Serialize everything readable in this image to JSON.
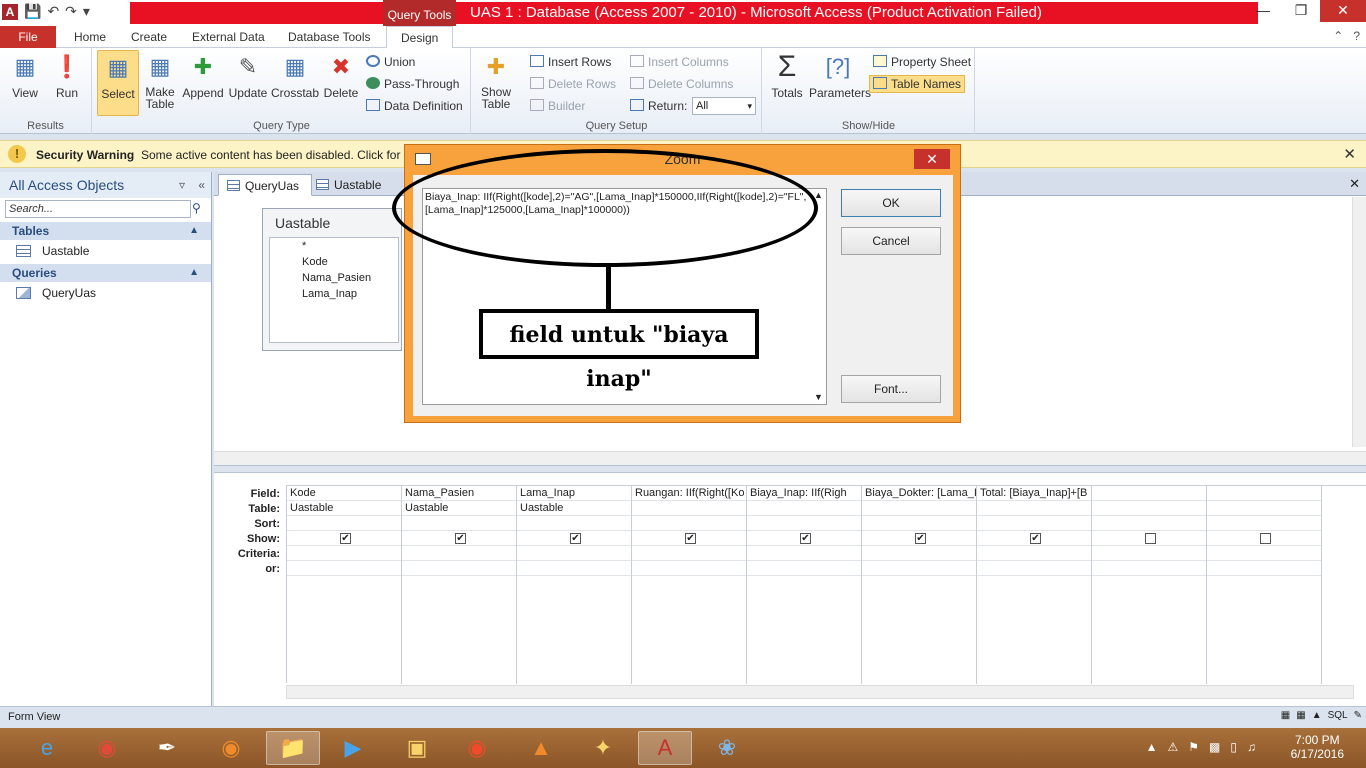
{
  "app": {
    "context_tab": "Query Tools",
    "window_title": "UAS 1 : Database (Access 2007 - 2010)  -  Microsoft Access (Product Activation Failed)",
    "icon_letter": "A"
  },
  "tabs": [
    "File",
    "Home",
    "Create",
    "External Data",
    "Database Tools",
    "Design"
  ],
  "ribbon": {
    "results": {
      "label": "Results",
      "view": "View",
      "run": "Run"
    },
    "query_type": {
      "label": "Query Type",
      "select": "Select",
      "make_table": "Make Table",
      "append": "Append",
      "update": "Update",
      "crosstab": "Crosstab",
      "delete": "Delete",
      "union": "Union",
      "pass_through": "Pass-Through",
      "data_definition": "Data Definition"
    },
    "query_setup": {
      "label": "Query Setup",
      "show_table": "Show Table",
      "insert_rows": "Insert Rows",
      "delete_rows": "Delete Rows",
      "builder": "Builder",
      "insert_columns": "Insert Columns",
      "delete_columns": "Delete Columns",
      "return_label": "Return:",
      "return_value": "All"
    },
    "show_hide": {
      "label": "Show/Hide",
      "totals": "Totals",
      "parameters": "Parameters",
      "property_sheet": "Property Sheet",
      "table_names": "Table Names"
    }
  },
  "security": {
    "title": "Security Warning",
    "message": "Some active content has been disabled. Click for mo"
  },
  "nav": {
    "header": "All Access Objects",
    "search_placeholder": "Search...",
    "groups": [
      {
        "name": "Tables",
        "items": [
          "Uastable"
        ]
      },
      {
        "name": "Queries",
        "items": [
          "QueryUas"
        ]
      }
    ]
  },
  "doc_tabs": [
    "QueryUas",
    "Uastable"
  ],
  "table_box": {
    "name": "Uastable",
    "fields": [
      "*",
      "Kode",
      "Nama_Pasien",
      "Lama_Inap"
    ]
  },
  "grid": {
    "row_labels": [
      "Field:",
      "Table:",
      "Sort:",
      "Show:",
      "Criteria:",
      "or:"
    ],
    "columns": [
      {
        "field": "Kode",
        "table": "Uastable",
        "show": true
      },
      {
        "field": "Nama_Pasien",
        "table": "Uastable",
        "show": true
      },
      {
        "field": "Lama_Inap",
        "table": "Uastable",
        "show": true
      },
      {
        "field": "Ruangan: IIf(Right([Ko",
        "table": "",
        "show": true
      },
      {
        "field": "Biaya_Inap: IIf(Righ",
        "table": "",
        "show": true
      },
      {
        "field": "Biaya_Dokter: [Lama_I",
        "table": "",
        "show": true
      },
      {
        "field": "Total: [Biaya_Inap]+[B",
        "table": "",
        "show": true
      },
      {
        "field": "",
        "table": "",
        "show": false
      },
      {
        "field": "",
        "table": "",
        "show": false
      }
    ]
  },
  "zoom": {
    "title": "Zoom",
    "expression": "Biaya_Inap: IIf(Right([kode],2)=\"AG\",[Lama_Inap]*150000,IIf(Right([kode],2)=\"FL\",[Lama_Inap]*125000,[Lama_Inap]*100000))",
    "ok": "OK",
    "cancel": "Cancel",
    "font": "Font..."
  },
  "annotation": {
    "text": "field untuk \"biaya inap\""
  },
  "status": {
    "text": "Form View",
    "view_sql": "SQL"
  },
  "taskbar": {
    "time": "7:00 PM",
    "date": "6/17/2016"
  }
}
